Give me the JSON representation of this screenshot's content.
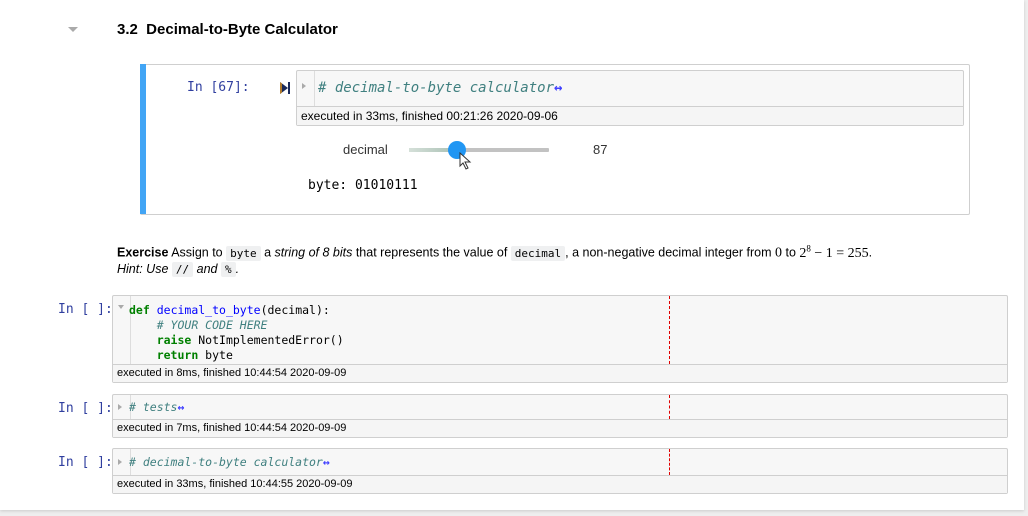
{
  "section": {
    "title": "3.2  Decimal-to-Byte Calculator",
    "collapse_icon": "caret-down-icon"
  },
  "selected_cell": {
    "prompt": "In [67]:",
    "run_icon": "run-cell-icon",
    "code_collapsed": "# decimal-to-byte calculator",
    "ellipsis": "↔",
    "exec_info": "executed in 33ms, finished 00:21:26 2020-09-06",
    "widget": {
      "label": "decimal",
      "value": "87",
      "min": 0,
      "max": 255,
      "fraction": 0.34
    },
    "output": "byte: 01010111"
  },
  "markdown": {
    "line1": {
      "bold": "Exercise",
      "t1": " Assign to ",
      "code1": "byte",
      "t2": " a ",
      "italic": "string of 8 bits",
      "t3": " that represents the value of ",
      "code2": "decimal",
      "t4": ", a non-negative decimal integer from ",
      "m1": "0",
      "t5": " to ",
      "m2": "2",
      "m2sup": "8",
      "m3": " − 1 = 255",
      "t6": "."
    },
    "line2": {
      "t1": "Hint: Use ",
      "code1": "//",
      "t2": " and ",
      "code2": "%",
      "t3": "."
    }
  },
  "cells": [
    {
      "prompt": "In [ ]:",
      "lines": [
        "def",
        " ",
        "decimal_to_byte",
        "(decimal):"
      ],
      "comment": "# YOUR CODE HERE",
      "raise_kw": "raise",
      "raise_rest": " NotImplementedError()",
      "return_kw": "return",
      "return_rest": " byte",
      "exec_info": "executed in 8ms, finished 10:44:54 2020-09-09"
    },
    {
      "prompt": "In [ ]:",
      "code_collapsed": "# tests",
      "ellipsis": "↔",
      "exec_info": "executed in 7ms, finished 10:44:54 2020-09-09"
    },
    {
      "prompt": "In [ ]:",
      "code_collapsed": "# decimal-to-byte calculator",
      "ellipsis": "↔",
      "exec_info": "executed in 33ms, finished 10:44:55 2020-09-09"
    }
  ],
  "colors": {
    "selected_bar": "#42a5f5",
    "prompt": "#303f9f",
    "slider_handle": "#2196f3",
    "comment": "#408080",
    "keyword": "#008000",
    "ruler": "#e00000"
  }
}
